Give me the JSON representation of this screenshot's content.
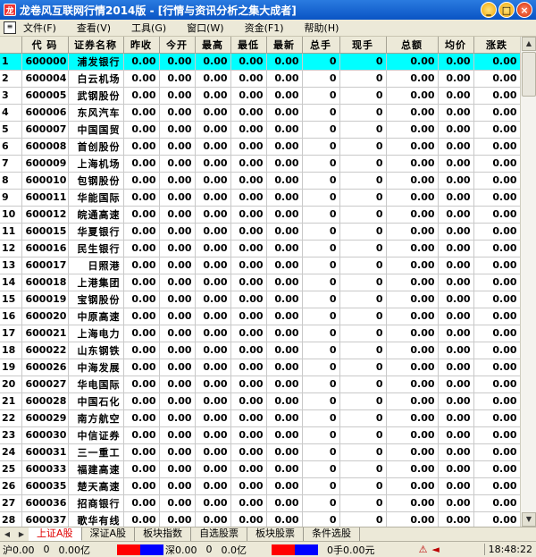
{
  "window": {
    "title": "龙卷风互联网行情2014版 - [行情与资讯分析之集大成者]",
    "app_icon": "app-logo-icon",
    "controls": {
      "minimize": "_",
      "maximize": "□",
      "close": "×"
    }
  },
  "menu": {
    "doc_icon": "document-icon",
    "items": [
      "文件(F)",
      "查看(V)",
      "工具(G)",
      "窗口(W)",
      "资金(F1)",
      "帮助(H)"
    ]
  },
  "table": {
    "headers": [
      "",
      "代 码",
      "证券名称",
      "昨收",
      "今开",
      "最高",
      "最低",
      "最新",
      "总手",
      "现手",
      "总额",
      "均价",
      "涨跌"
    ],
    "rows": [
      [
        "1",
        "600000",
        "浦发银行",
        "0.00",
        "0.00",
        "0.00",
        "0.00",
        "0.00",
        "0",
        "0",
        "0.00",
        "0.00",
        "0.00"
      ],
      [
        "2",
        "600004",
        "白云机场",
        "0.00",
        "0.00",
        "0.00",
        "0.00",
        "0.00",
        "0",
        "0",
        "0.00",
        "0.00",
        "0.00"
      ],
      [
        "3",
        "600005",
        "武钢股份",
        "0.00",
        "0.00",
        "0.00",
        "0.00",
        "0.00",
        "0",
        "0",
        "0.00",
        "0.00",
        "0.00"
      ],
      [
        "4",
        "600006",
        "东风汽车",
        "0.00",
        "0.00",
        "0.00",
        "0.00",
        "0.00",
        "0",
        "0",
        "0.00",
        "0.00",
        "0.00"
      ],
      [
        "5",
        "600007",
        "中国国贸",
        "0.00",
        "0.00",
        "0.00",
        "0.00",
        "0.00",
        "0",
        "0",
        "0.00",
        "0.00",
        "0.00"
      ],
      [
        "6",
        "600008",
        "首创股份",
        "0.00",
        "0.00",
        "0.00",
        "0.00",
        "0.00",
        "0",
        "0",
        "0.00",
        "0.00",
        "0.00"
      ],
      [
        "7",
        "600009",
        "上海机场",
        "0.00",
        "0.00",
        "0.00",
        "0.00",
        "0.00",
        "0",
        "0",
        "0.00",
        "0.00",
        "0.00"
      ],
      [
        "8",
        "600010",
        "包钢股份",
        "0.00",
        "0.00",
        "0.00",
        "0.00",
        "0.00",
        "0",
        "0",
        "0.00",
        "0.00",
        "0.00"
      ],
      [
        "9",
        "600011",
        "华能国际",
        "0.00",
        "0.00",
        "0.00",
        "0.00",
        "0.00",
        "0",
        "0",
        "0.00",
        "0.00",
        "0.00"
      ],
      [
        "10",
        "600012",
        "皖通高速",
        "0.00",
        "0.00",
        "0.00",
        "0.00",
        "0.00",
        "0",
        "0",
        "0.00",
        "0.00",
        "0.00"
      ],
      [
        "11",
        "600015",
        "华夏银行",
        "0.00",
        "0.00",
        "0.00",
        "0.00",
        "0.00",
        "0",
        "0",
        "0.00",
        "0.00",
        "0.00"
      ],
      [
        "12",
        "600016",
        "民生银行",
        "0.00",
        "0.00",
        "0.00",
        "0.00",
        "0.00",
        "0",
        "0",
        "0.00",
        "0.00",
        "0.00"
      ],
      [
        "13",
        "600017",
        "日照港",
        "0.00",
        "0.00",
        "0.00",
        "0.00",
        "0.00",
        "0",
        "0",
        "0.00",
        "0.00",
        "0.00"
      ],
      [
        "14",
        "600018",
        "上港集团",
        "0.00",
        "0.00",
        "0.00",
        "0.00",
        "0.00",
        "0",
        "0",
        "0.00",
        "0.00",
        "0.00"
      ],
      [
        "15",
        "600019",
        "宝钢股份",
        "0.00",
        "0.00",
        "0.00",
        "0.00",
        "0.00",
        "0",
        "0",
        "0.00",
        "0.00",
        "0.00"
      ],
      [
        "16",
        "600020",
        "中原高速",
        "0.00",
        "0.00",
        "0.00",
        "0.00",
        "0.00",
        "0",
        "0",
        "0.00",
        "0.00",
        "0.00"
      ],
      [
        "17",
        "600021",
        "上海电力",
        "0.00",
        "0.00",
        "0.00",
        "0.00",
        "0.00",
        "0",
        "0",
        "0.00",
        "0.00",
        "0.00"
      ],
      [
        "18",
        "600022",
        "山东钢铁",
        "0.00",
        "0.00",
        "0.00",
        "0.00",
        "0.00",
        "0",
        "0",
        "0.00",
        "0.00",
        "0.00"
      ],
      [
        "19",
        "600026",
        "中海发展",
        "0.00",
        "0.00",
        "0.00",
        "0.00",
        "0.00",
        "0",
        "0",
        "0.00",
        "0.00",
        "0.00"
      ],
      [
        "20",
        "600027",
        "华电国际",
        "0.00",
        "0.00",
        "0.00",
        "0.00",
        "0.00",
        "0",
        "0",
        "0.00",
        "0.00",
        "0.00"
      ],
      [
        "21",
        "600028",
        "中国石化",
        "0.00",
        "0.00",
        "0.00",
        "0.00",
        "0.00",
        "0",
        "0",
        "0.00",
        "0.00",
        "0.00"
      ],
      [
        "22",
        "600029",
        "南方航空",
        "0.00",
        "0.00",
        "0.00",
        "0.00",
        "0.00",
        "0",
        "0",
        "0.00",
        "0.00",
        "0.00"
      ],
      [
        "23",
        "600030",
        "中信证券",
        "0.00",
        "0.00",
        "0.00",
        "0.00",
        "0.00",
        "0",
        "0",
        "0.00",
        "0.00",
        "0.00"
      ],
      [
        "24",
        "600031",
        "三一重工",
        "0.00",
        "0.00",
        "0.00",
        "0.00",
        "0.00",
        "0",
        "0",
        "0.00",
        "0.00",
        "0.00"
      ],
      [
        "25",
        "600033",
        "福建高速",
        "0.00",
        "0.00",
        "0.00",
        "0.00",
        "0.00",
        "0",
        "0",
        "0.00",
        "0.00",
        "0.00"
      ],
      [
        "26",
        "600035",
        "楚天高速",
        "0.00",
        "0.00",
        "0.00",
        "0.00",
        "0.00",
        "0",
        "0",
        "0.00",
        "0.00",
        "0.00"
      ],
      [
        "27",
        "600036",
        "招商银行",
        "0.00",
        "0.00",
        "0.00",
        "0.00",
        "0.00",
        "0",
        "0",
        "0.00",
        "0.00",
        "0.00"
      ],
      [
        "28",
        "600037",
        "歌华有线",
        "0.00",
        "0.00",
        "0.00",
        "0.00",
        "0.00",
        "0",
        "0",
        "0.00",
        "0.00",
        "0.00"
      ]
    ],
    "selected_row": 1
  },
  "tabs": {
    "items": [
      "上证A股",
      "深证A股",
      "板块指数",
      "自选股票",
      "板块股票",
      "条件选股"
    ],
    "active": "上证A股"
  },
  "status": {
    "sh_index": "沪0.00",
    "sh_change": "0",
    "sh_amount": "0.00亿",
    "sz_index": "深0.00",
    "sz_change": "0",
    "sz_amount": "0.0亿",
    "hands": "0手0.00元",
    "clock": "18:48:22",
    "colors": {
      "up": "#ff0000",
      "down": "#0000ff",
      "accent_selected": "#00ffff"
    }
  }
}
